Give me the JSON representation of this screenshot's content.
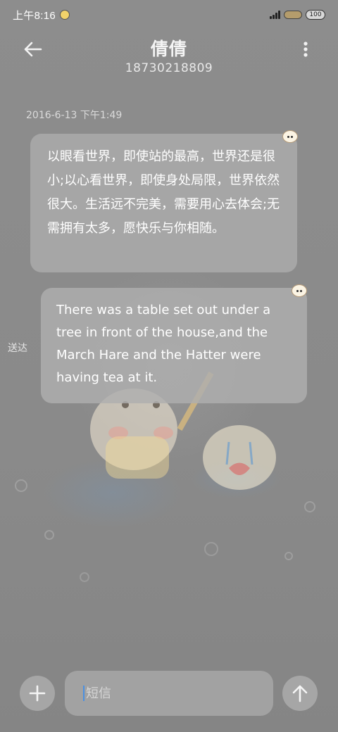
{
  "status_bar": {
    "time": "上午8:16",
    "battery": "100"
  },
  "header": {
    "contact_name": "倩倩",
    "contact_number": "18730218809"
  },
  "conversation": {
    "timestamp": "2016-6-13 下午1:49",
    "messages": [
      {
        "direction": "incoming",
        "text": "以眼看世界，即使站的最高，世界还是很小;以心看世界，即使身处局限，世界依然很大。生活远不完美，需要用心去体会;无需拥有太多，愿快乐与你相随。"
      },
      {
        "direction": "outgoing",
        "text": "There was a table set out under a tree in front of the house,and the March Hare and the Hatter were having tea at it.",
        "status": "送达"
      }
    ]
  },
  "composer": {
    "placeholder": "短信"
  },
  "icons": {
    "back": "back-arrow-icon",
    "more": "more-vertical-icon",
    "add": "plus-icon",
    "send": "arrow-up-icon"
  }
}
